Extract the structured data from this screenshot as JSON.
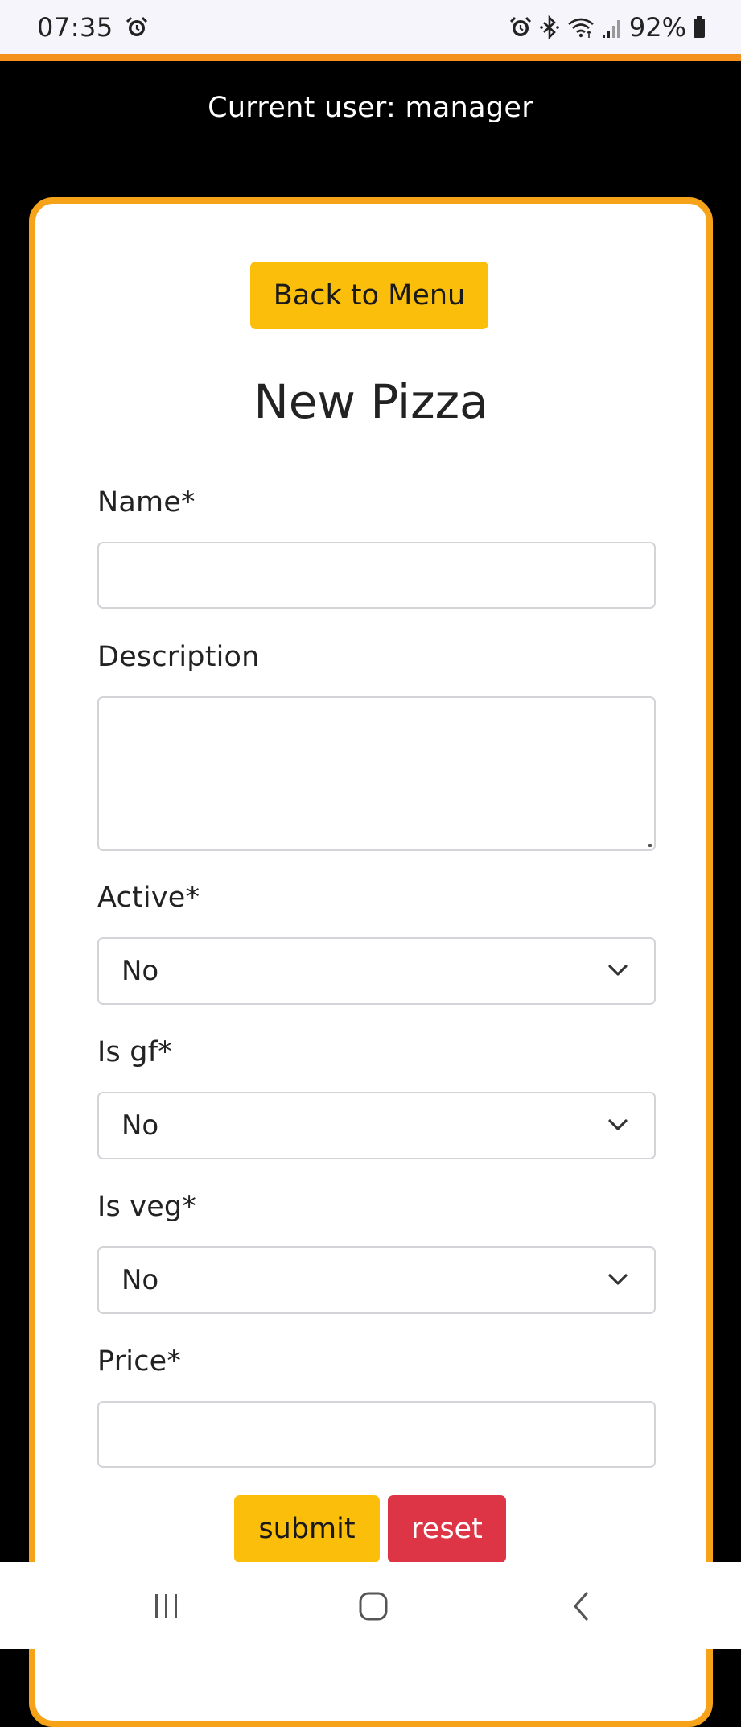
{
  "status_bar": {
    "time": "07:35",
    "battery": "92%",
    "icons": [
      "alarm-icon",
      "bluetooth-icon",
      "wifi-icon",
      "signal-icon",
      "battery-icon"
    ]
  },
  "header": {
    "current_user": "Current user: manager"
  },
  "form": {
    "back_button_label": "Back to Menu",
    "title": "New Pizza",
    "fields": {
      "name": {
        "label": "Name*",
        "value": ""
      },
      "description": {
        "label": "Description",
        "value": ""
      },
      "active": {
        "label": "Active*",
        "value": "No"
      },
      "is_gf": {
        "label": "Is gf*",
        "value": "No"
      },
      "is_veg": {
        "label": "Is veg*",
        "value": "No"
      },
      "price": {
        "label": "Price*",
        "value": ""
      }
    },
    "submit_label": "submit",
    "reset_label": "reset"
  },
  "colors": {
    "accent_orange": "#f6a31a",
    "button_yellow": "#fbbf0b",
    "reset_red": "#dd3545",
    "background": "#000000"
  },
  "nav_bar": {
    "buttons": [
      "recent-apps-icon",
      "home-icon",
      "back-icon"
    ]
  }
}
